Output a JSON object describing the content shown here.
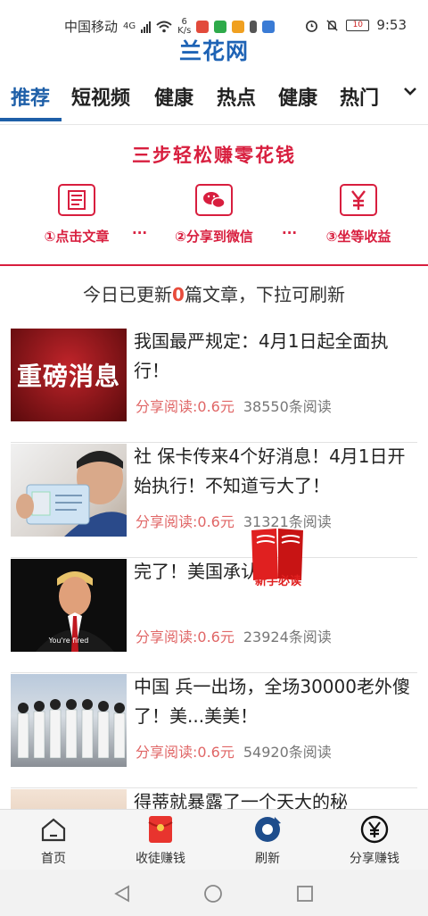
{
  "status_bar": {
    "carrier": "中国移动",
    "network_gen": "4G",
    "speed_value": "6",
    "speed_unit": "K/s",
    "battery": "10",
    "time": "9:53"
  },
  "app_title": "兰花网",
  "tabs": [
    {
      "label": "推荐",
      "active": true
    },
    {
      "label": "短视频"
    },
    {
      "label": "健康"
    },
    {
      "label": "热点"
    },
    {
      "label": "健康"
    },
    {
      "label": "热门"
    }
  ],
  "promo": {
    "title": "三步轻松赚零花钱",
    "steps": [
      {
        "label": "①点击文章",
        "icon": "article-icon"
      },
      {
        "label": "②分享到微信",
        "icon": "wechat-icon"
      },
      {
        "label": "③坐等收益",
        "icon": "yuan-icon"
      }
    ],
    "separator": "···"
  },
  "update_notice": {
    "prefix": "今日已更新",
    "count": "0",
    "suffix": "篇文章，下拉可刷新"
  },
  "articles": [
    {
      "title": "我国最严规定：4月1日起全面执行！",
      "share": "分享阅读:0.6元",
      "reads": "38550条阅读",
      "thumb_text": "重磅消息"
    },
    {
      "title": "社 保卡传来4个好消息！4月1日开始执行！不知道亏大了！",
      "share": "分享阅读:0.6元",
      "reads": "31321条阅读"
    },
    {
      "title": "完了！美国承认了...",
      "share": "分享阅读:0.6元",
      "reads": "23924条阅读",
      "thumb_text": "You're fired"
    },
    {
      "title": "中国 兵一出场，全场30000老外傻了！美...美美！",
      "share": "分享阅读:0.6元",
      "reads": "54920条阅读"
    },
    {
      "title": "得蒂就暴露了一个天大的秘",
      "share": "",
      "reads": ""
    }
  ],
  "float_badge": {
    "label": "新手必读"
  },
  "bottom_nav": [
    {
      "label": "首页",
      "icon": "home-icon"
    },
    {
      "label": "收徒赚钱",
      "icon": "red-envelope-icon"
    },
    {
      "label": "刷新",
      "icon": "refresh-icon"
    },
    {
      "label": "分享赚钱",
      "icon": "yuan-circle-icon"
    }
  ],
  "colors": {
    "brand_blue": "#1e5fa8",
    "promo_red": "#d81e3e",
    "share_red": "#e06666"
  }
}
